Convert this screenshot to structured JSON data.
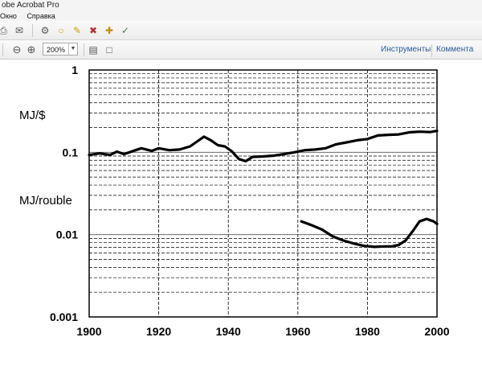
{
  "window": {
    "title": "obe Acrobat Pro"
  },
  "menu": {
    "items": [
      "Окно",
      "Справка"
    ]
  },
  "toolbar": {
    "zoom_value": "200%",
    "tools_label": "Инструменты",
    "comments_label": "Коммента"
  },
  "chart_data": {
    "type": "line",
    "xlabel": "",
    "ylabel": "",
    "xlim": [
      1900,
      2000
    ],
    "ylim": [
      0.001,
      1
    ],
    "yscale": "log",
    "grid": true,
    "x_ticks": [
      "1900",
      "1920",
      "1940",
      "1960",
      "1980",
      "2000"
    ],
    "y_ticks": [
      "1",
      "0.1",
      "0.01",
      "0.001"
    ],
    "annotations": [
      "MJ/$",
      "MJ/rouble"
    ],
    "series": [
      {
        "x": [
          1900,
          1903,
          1906,
          1908,
          1910,
          1913,
          1915,
          1918,
          1920,
          1923,
          1926,
          1929,
          1931,
          1933,
          1935,
          1937,
          1939,
          1941,
          1943,
          1945,
          1947,
          1950,
          1953,
          1956,
          1959,
          1962,
          1965,
          1968,
          1971,
          1974,
          1977,
          1980,
          1983,
          1986,
          1989,
          1992,
          1995,
          1998,
          2000
        ],
        "y": [
          0.093,
          0.097,
          0.093,
          0.102,
          0.095,
          0.105,
          0.112,
          0.104,
          0.112,
          0.106,
          0.108,
          0.118,
          0.135,
          0.155,
          0.14,
          0.122,
          0.118,
          0.103,
          0.083,
          0.078,
          0.088,
          0.089,
          0.091,
          0.095,
          0.1,
          0.106,
          0.108,
          0.112,
          0.125,
          0.132,
          0.14,
          0.145,
          0.16,
          0.163,
          0.165,
          0.175,
          0.178,
          0.176,
          0.182
        ]
      },
      {
        "x": [
          1961,
          1964,
          1967,
          1970,
          1973,
          1976,
          1979,
          1982,
          1985,
          1987,
          1989,
          1991,
          1993,
          1995,
          1997,
          1999,
          2000
        ],
        "y": [
          0.0145,
          0.013,
          0.0115,
          0.0095,
          0.0085,
          0.0078,
          0.0073,
          0.0071,
          0.0072,
          0.0072,
          0.0075,
          0.0085,
          0.011,
          0.0145,
          0.0155,
          0.0145,
          0.0135
        ]
      }
    ]
  }
}
